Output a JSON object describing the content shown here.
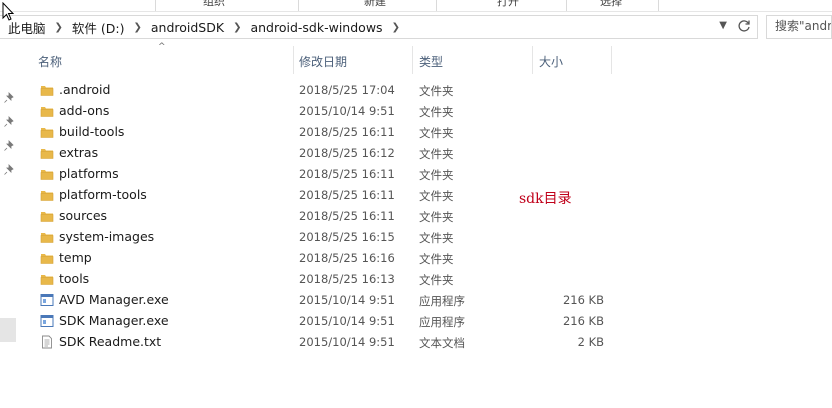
{
  "ribbon": {
    "groups": [
      "组织",
      "新建",
      "打开",
      "选择"
    ]
  },
  "breadcrumb": {
    "items": [
      "此电脑",
      "软件 (D:)",
      "androidSDK",
      "android-sdk-windows"
    ]
  },
  "search": {
    "placeholder": "搜索\"android-sdk-windows\""
  },
  "columns": {
    "name": "名称",
    "date": "修改日期",
    "type": "类型",
    "size": "大小"
  },
  "files": [
    {
      "name": ".android",
      "date": "2018/5/25 17:04",
      "type": "文件夹",
      "size": "",
      "icon": "folder-icon"
    },
    {
      "name": "add-ons",
      "date": "2015/10/14 9:51",
      "type": "文件夹",
      "size": "",
      "icon": "folder-icon"
    },
    {
      "name": "build-tools",
      "date": "2018/5/25 16:11",
      "type": "文件夹",
      "size": "",
      "icon": "folder-icon"
    },
    {
      "name": "extras",
      "date": "2018/5/25 16:12",
      "type": "文件夹",
      "size": "",
      "icon": "folder-icon"
    },
    {
      "name": "platforms",
      "date": "2018/5/25 16:11",
      "type": "文件夹",
      "size": "",
      "icon": "folder-icon"
    },
    {
      "name": "platform-tools",
      "date": "2018/5/25 16:11",
      "type": "文件夹",
      "size": "",
      "icon": "folder-icon"
    },
    {
      "name": "sources",
      "date": "2018/5/25 16:11",
      "type": "文件夹",
      "size": "",
      "icon": "folder-icon"
    },
    {
      "name": "system-images",
      "date": "2018/5/25 16:15",
      "type": "文件夹",
      "size": "",
      "icon": "folder-icon"
    },
    {
      "name": "temp",
      "date": "2018/5/25 16:16",
      "type": "文件夹",
      "size": "",
      "icon": "folder-icon"
    },
    {
      "name": "tools",
      "date": "2018/5/25 16:13",
      "type": "文件夹",
      "size": "",
      "icon": "folder-icon"
    },
    {
      "name": "AVD Manager.exe",
      "date": "2015/10/14 9:51",
      "type": "应用程序",
      "size": "216 KB",
      "icon": "exe-icon"
    },
    {
      "name": "SDK Manager.exe",
      "date": "2015/10/14 9:51",
      "type": "应用程序",
      "size": "216 KB",
      "icon": "exe-icon"
    },
    {
      "name": "SDK Readme.txt",
      "date": "2015/10/14 9:51",
      "type": "文本文档",
      "size": "2 KB",
      "icon": "text-file-icon"
    }
  ],
  "annotation": "sdk目录",
  "colors": {
    "folder": "#e8b84a",
    "folder_dark": "#d4a032",
    "header_text": "#4c607a",
    "annotation": "#c0001a"
  }
}
